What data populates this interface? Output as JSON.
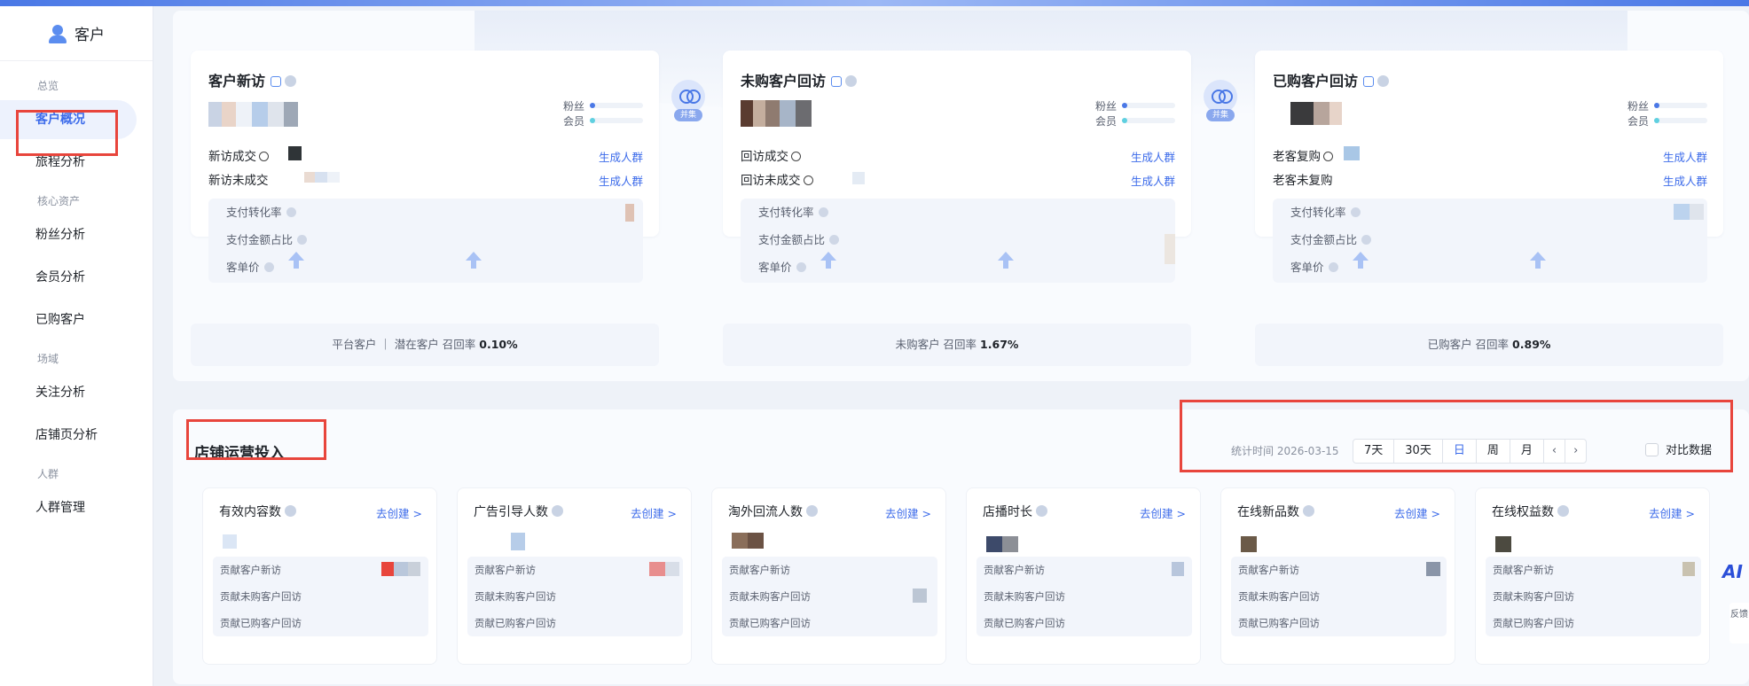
{
  "sidebar": {
    "title": "客户",
    "groups": [
      {
        "label": "总览",
        "items": [
          "客户概况",
          "旅程分析"
        ]
      },
      {
        "label": "核心资产",
        "items": [
          "粉丝分析",
          "会员分析",
          "已购客户"
        ]
      },
      {
        "label": "场域",
        "items": [
          "关注分析",
          "店铺页分析"
        ]
      },
      {
        "label": "人群",
        "items": [
          "人群管理"
        ]
      }
    ],
    "active_item": "客户概况"
  },
  "journey": {
    "link_label": "并集",
    "cards": [
      {
        "title": "客户新访",
        "legend": [
          "粉丝",
          "会员"
        ],
        "rows": [
          {
            "label": "新访成交",
            "action": "生成人群"
          },
          {
            "label": "新访未成交",
            "action": "生成人群"
          }
        ],
        "metrics": [
          "支付转化率",
          "支付金额占比",
          "客单价"
        ],
        "footer_prefix": "平台客户 ｜ 潜在客户  召回率",
        "footer_value": "0.10%"
      },
      {
        "title": "未购客户回访",
        "legend": [
          "粉丝",
          "会员"
        ],
        "rows": [
          {
            "label": "回访成交",
            "action": "生成人群"
          },
          {
            "label": "回访未成交",
            "action": "生成人群"
          }
        ],
        "metrics": [
          "支付转化率",
          "支付金额占比",
          "客单价"
        ],
        "footer_prefix": "未购客户  召回率",
        "footer_value": "1.67%"
      },
      {
        "title": "已购客户回访",
        "legend": [
          "粉丝",
          "会员"
        ],
        "rows": [
          {
            "label": "老客复购",
            "action": "生成人群"
          },
          {
            "label": "老客未复购",
            "action": "生成人群"
          }
        ],
        "metrics": [
          "支付转化率",
          "支付金额占比",
          "客单价"
        ],
        "footer_prefix": "已购客户  召回率",
        "footer_value": "0.89%"
      }
    ]
  },
  "ops": {
    "title": "店铺运营投入",
    "stat_time": "统计时间 2026-03-15",
    "tabs": [
      "7天",
      "30天",
      "日",
      "周",
      "月"
    ],
    "selected_tab": "日",
    "compare_label": "对比数据",
    "cards": [
      {
        "title": "有效内容数",
        "link": "去创建 >"
      },
      {
        "title": "广告引导人数",
        "link": "去创建 >"
      },
      {
        "title": "淘外回流人数",
        "link": "去创建 >"
      },
      {
        "title": "店播时长",
        "link": "去创建 >"
      },
      {
        "title": "在线新品数",
        "link": "去创建 >"
      },
      {
        "title": "在线权益数",
        "link": "去创建 >"
      }
    ],
    "row_labels": [
      "贡献客户新访",
      "贡献未购客户回访",
      "贡献已购客户回访"
    ]
  },
  "floating": {
    "ai": "AI",
    "feedback": "反馈"
  },
  "colors": {
    "accent": "#3c6bea",
    "highlight": "#e8453c"
  }
}
